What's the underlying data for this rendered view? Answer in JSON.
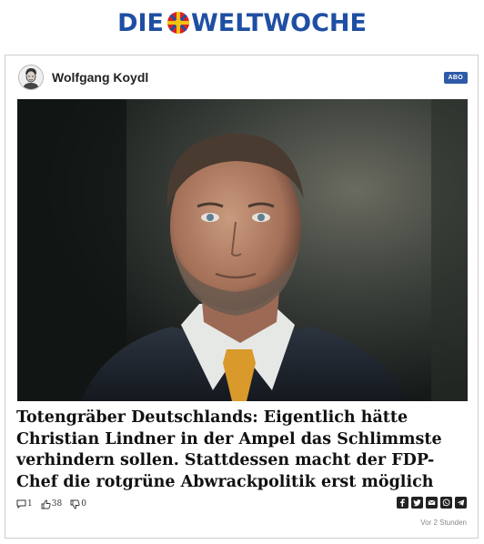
{
  "brand": {
    "part1": "DIE",
    "part2": "WELTWOCHE",
    "color": "#1f4fa3"
  },
  "article": {
    "author": "Wolfgang Koydl",
    "badge": "ABO",
    "headline": "Totengräber Deutschlands: Eigentlich hätte Christian Lindner in der Ampel das Schlimmste verhindern sollen. Stattdessen macht der FDP-Chef die rotgrüne Abwrackpolitik erst möglich",
    "comments": "1",
    "likes": "38",
    "dislikes": "0",
    "time": "Vor 2 Stunden"
  },
  "share_icons": [
    "facebook-icon",
    "twitter-icon",
    "email-icon",
    "whatsapp-icon",
    "telegram-icon"
  ]
}
